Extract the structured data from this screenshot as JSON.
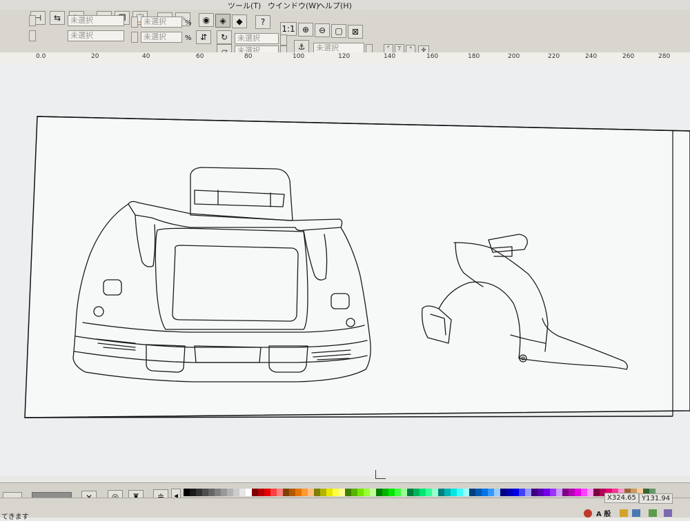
{
  "menu": {
    "tools": "ツール(T)",
    "window": "ウインドウ(W)",
    "help": "ヘルプ(H)"
  },
  "toolbar": {
    "unselected": "未選択",
    "percent": "%",
    "zoom_actual": "1:1",
    "help_icon": "?"
  },
  "ruler": {
    "ticks": [
      "0.0",
      "20",
      "40",
      "60",
      "80",
      "100",
      "120",
      "140",
      "160",
      "180",
      "200",
      "220",
      "240",
      "260",
      "280"
    ]
  },
  "status": {
    "message": "てきます",
    "x_coord": "X324.65",
    "y_coord": "Y131.94",
    "ime": "A 般"
  },
  "colors": {
    "accent": "#3a6ea5",
    "paper": "#f7f8f8",
    "line": "#1a1a1a"
  }
}
